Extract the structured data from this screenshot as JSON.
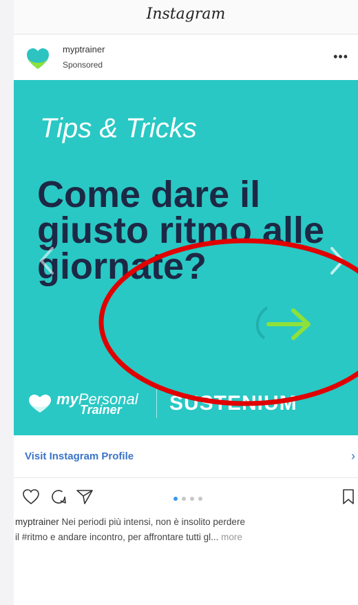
{
  "app": {
    "title": "Instagram"
  },
  "post": {
    "account": "myptrainer",
    "label": "Sponsored",
    "more_icon": "more-horizontal-icon",
    "creative": {
      "tips": "Tips & Tricks",
      "headline": "Come dare il giusto ritmo alle giornate?",
      "brand_my": "my",
      "brand_personal": "Personal",
      "brand_trainer": "Trainer",
      "brand_partner": "SUSTENIUM",
      "background": "#29c8c4",
      "accent_arrow": "#8ee03a"
    },
    "cta": {
      "label": "Visit Instagram Profile",
      "chevron": "›"
    },
    "carousel": {
      "count": 4,
      "active": 1
    },
    "caption": {
      "user": "myptrainer",
      "line1": " Nei periodi più intensi, non è insolito perdere",
      "line2": "il #ritmo e andare incontro, per affrontare tutti gl...",
      "more": "more"
    }
  },
  "colors": {
    "link": "#3b74c8",
    "annotation": "#e00000"
  }
}
